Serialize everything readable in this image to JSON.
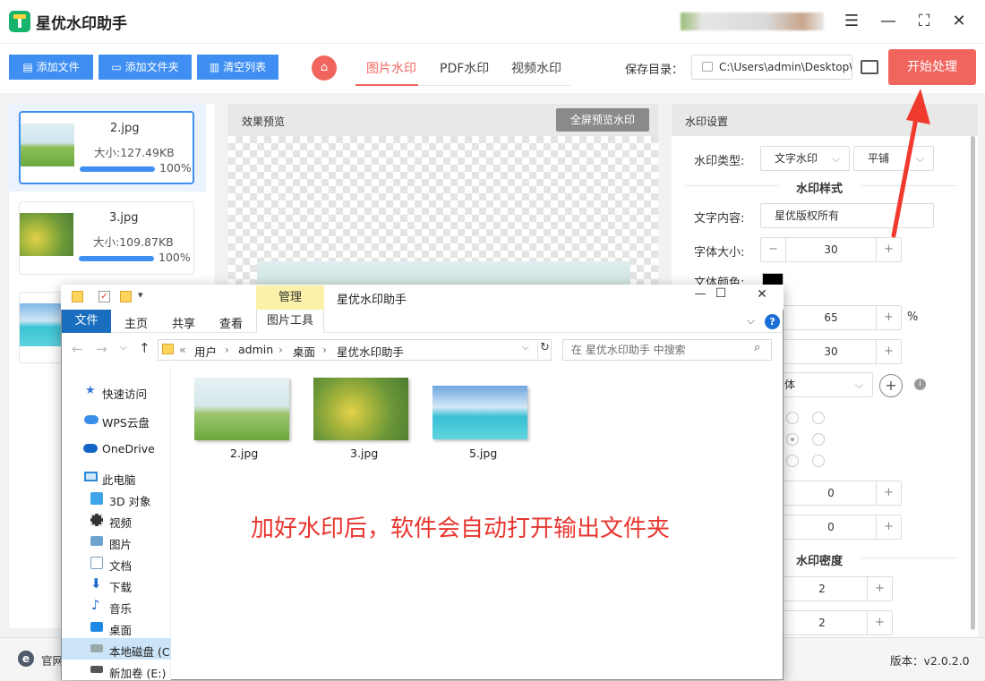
{
  "app": {
    "title": "星优水印助手"
  },
  "window_controls": {
    "settings": "☰",
    "minimize": "—",
    "maximize": "⛶",
    "close": "✕"
  },
  "toolbar": {
    "add_file": "添加文件",
    "add_folder": "添加文件夹",
    "clear_list": "清空列表",
    "tabs": [
      "图片水印",
      "PDF水印",
      "视频水印"
    ],
    "active_tab": "图片水印",
    "save_label": "保存目录：",
    "save_path": "C:\\Users\\admin\\Desktop\\",
    "start": "开始处理"
  },
  "files": [
    {
      "name": "2.jpg",
      "size": "大小:127.49KB",
      "progress": "100%"
    },
    {
      "name": "3.jpg",
      "size": "大小:109.87KB",
      "progress": "100%"
    }
  ],
  "preview": {
    "title": "效果预览",
    "fullscreen_btn": "全屏预览水印"
  },
  "settings": {
    "title": "水印设置",
    "type_label": "水印类型:",
    "type_value": "文字水印",
    "layout_value": "平铺",
    "style_section": "水印样式",
    "text_label": "文字内容:",
    "text_value": "星优版权所有",
    "font_size_label": "字体大小:",
    "font_size": "30",
    "font_color_label": "文体颜色:",
    "opacity": "65",
    "opacity_unit": "%",
    "rotation": "30",
    "font_face": "体",
    "offset_x": "0",
    "offset_y": "0",
    "density_section": "水印密度",
    "density_x": "2",
    "density_y": "2",
    "minus": "−",
    "plus": "+"
  },
  "status": {
    "website": "官网",
    "version": "版本：v2.0.2.0"
  },
  "annotation": "加好水印后，软件会自动打开输出文件夹",
  "explorer": {
    "title": "星优水印助手",
    "manage_tab": "管理",
    "ribbon": [
      "文件",
      "主页",
      "共享",
      "查看",
      "图片工具"
    ],
    "breadcrumb": [
      "用户",
      "admin",
      "桌面",
      "星优水印助手"
    ],
    "search_placeholder": "在 星优水印助手 中搜索",
    "nav": [
      "快速访问",
      "WPS云盘",
      "OneDrive",
      "此电脑",
      "3D 对象",
      "视频",
      "图片",
      "文档",
      "下载",
      "音乐",
      "桌面",
      "本地磁盘 (C:",
      "新加卷 (E:)"
    ],
    "files": [
      "2.jpg",
      "3.jpg",
      "5.jpg"
    ],
    "controls": {
      "minimize": "—",
      "maximize": "☐",
      "close": "✕"
    }
  }
}
